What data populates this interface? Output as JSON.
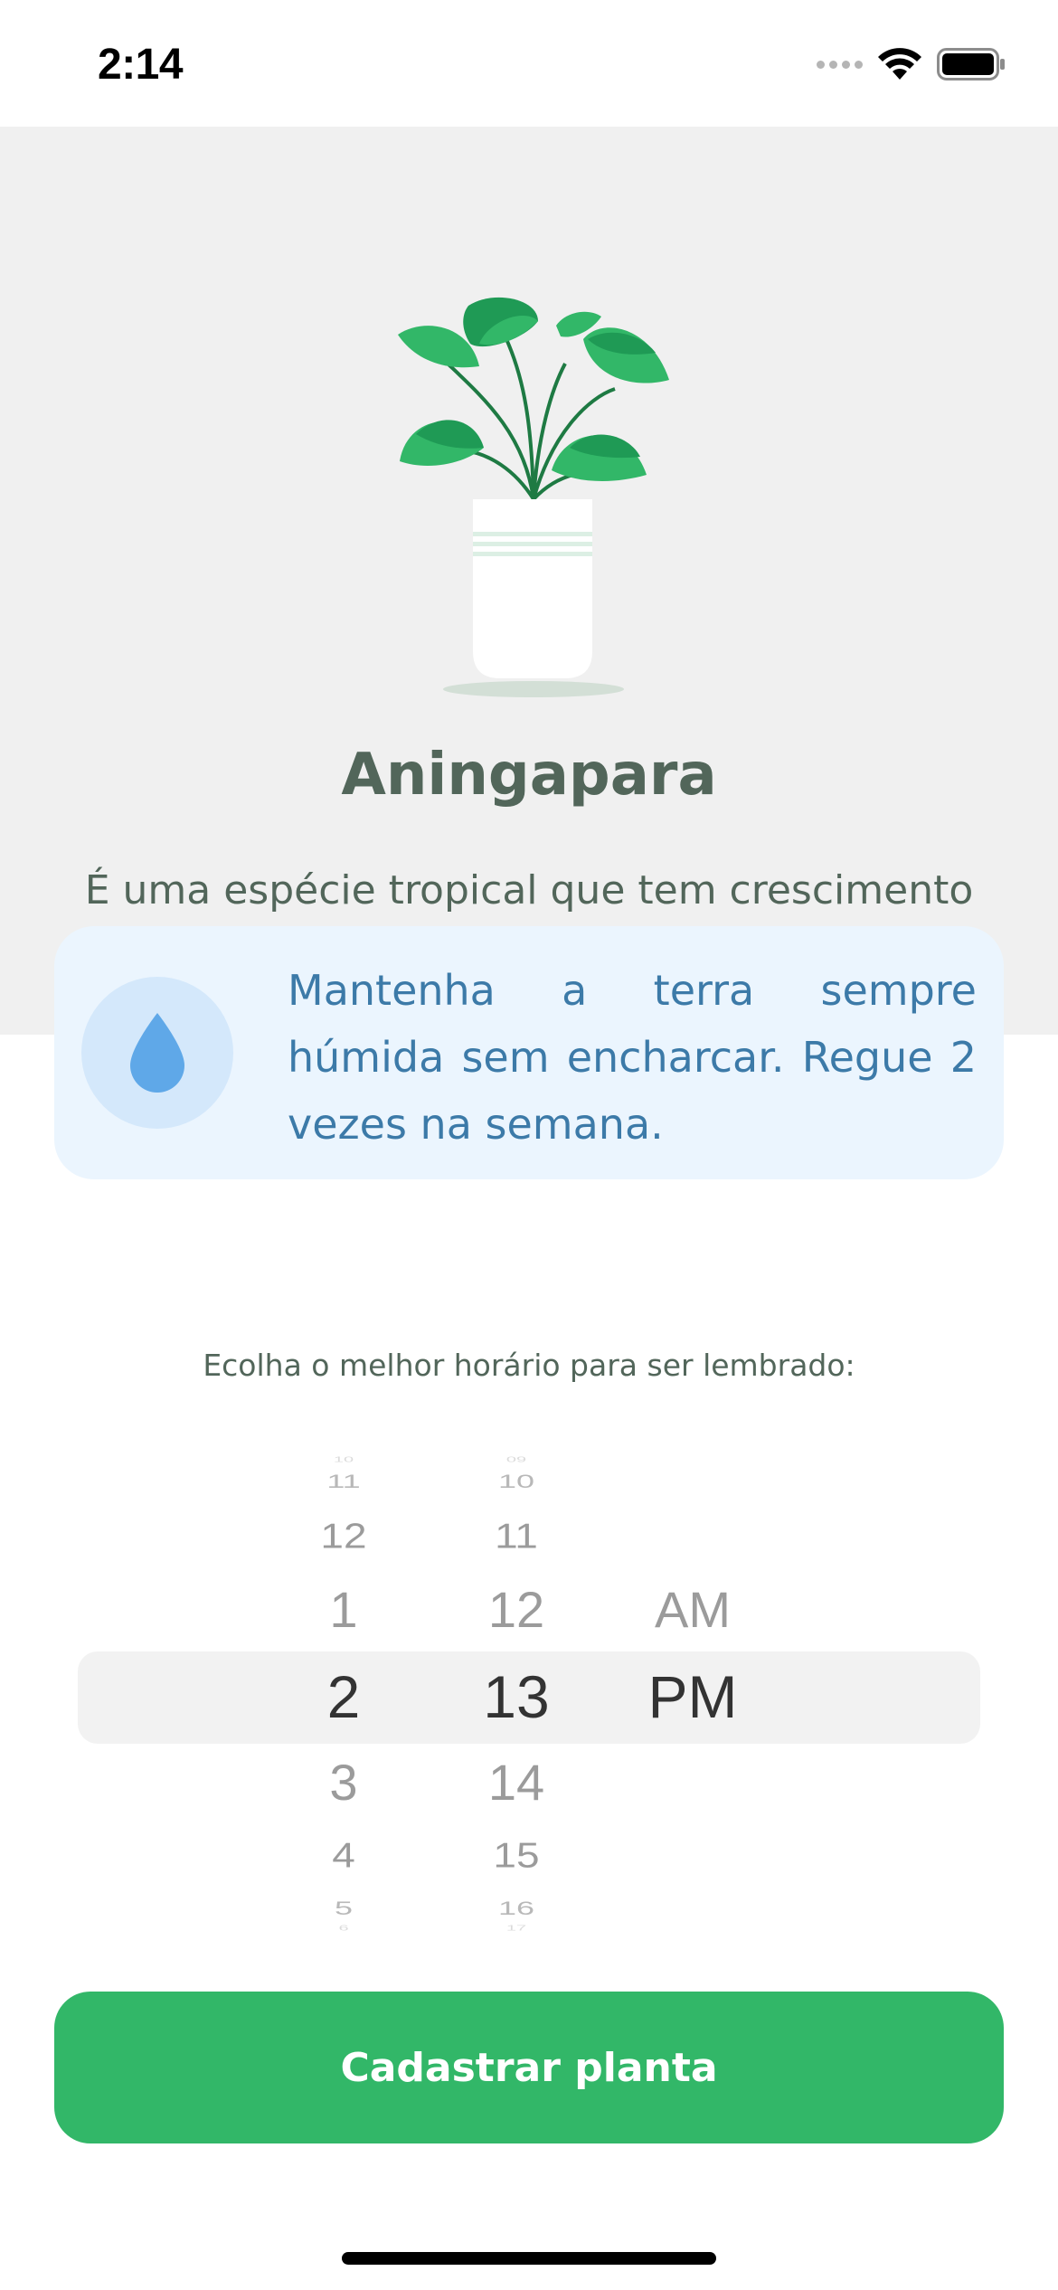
{
  "status_bar": {
    "time": "2:14"
  },
  "plant": {
    "name": "Aningapara",
    "about": "É uma espécie tropical que tem crescimento rápido e fácil manuseio.",
    "water_tip": "Mantenha a terra sempre húmida sem encharcar. Regue 2 vezes na semana."
  },
  "alert_label": "Ecolha o melhor horário para ser lembrado:",
  "time_picker": {
    "hours": [
      "10",
      "11",
      "12",
      "1",
      "2",
      "3",
      "4",
      "5",
      "6"
    ],
    "minutes": [
      "09",
      "10",
      "11",
      "12",
      "13",
      "14",
      "15",
      "16",
      "17"
    ],
    "periods": [
      "AM",
      "PM"
    ],
    "selected_hour": "2",
    "selected_minute": "13",
    "selected_period": "PM"
  },
  "submit_label": "Cadastrar planta",
  "colors": {
    "heading": "#52665a",
    "hero_bg": "#f0f0f0",
    "tip_bg": "#ebf5fe",
    "tip_text": "#3c7aa8",
    "button": "#32b768"
  },
  "icons": {
    "hero": "potted-plant-icon",
    "tip": "water-drop-icon",
    "status": [
      "cellular-signal-icon",
      "wifi-icon",
      "battery-icon"
    ]
  }
}
